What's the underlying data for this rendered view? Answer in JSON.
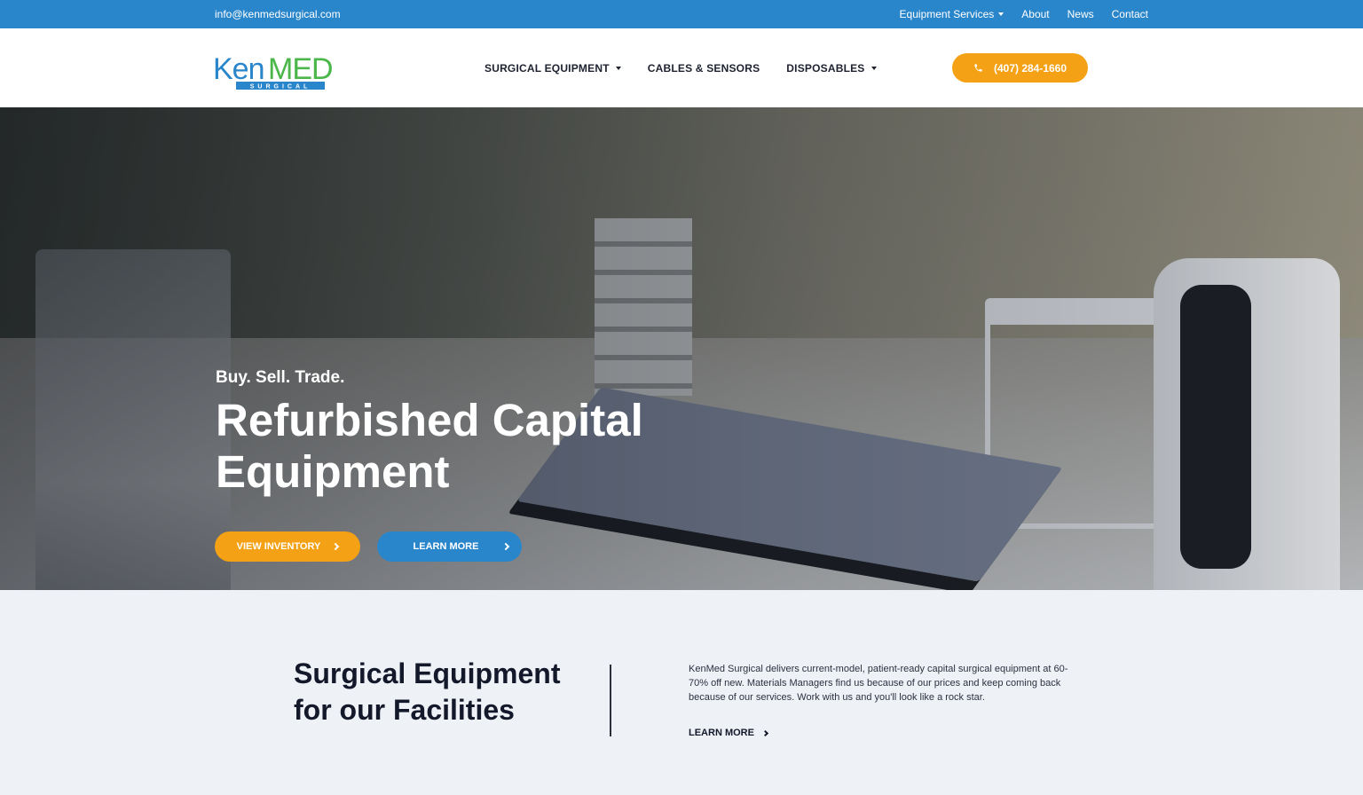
{
  "topbar": {
    "email": "info@kenmedsurgical.com",
    "links": [
      "Equipment Services",
      "About",
      "News",
      "Contact"
    ]
  },
  "header": {
    "logo_text": "KenMED",
    "logo_sub": "SURGICAL",
    "nav": [
      "SURGICAL EQUIPMENT",
      "CABLES & SENSORS",
      "DISPOSABLES"
    ],
    "phone": "(407) 284-1660"
  },
  "hero": {
    "kicker": "Buy. Sell. Trade.",
    "title": "Refurbished Capital Equipment",
    "primary_button": "VIEW INVENTORY",
    "secondary_button": "LEARN MORE"
  },
  "intro": {
    "heading": "Surgical Equipment for our Facilities",
    "body": "KenMed Surgical delivers current-model, patient-ready capital surgical equipment at 60-70% off new. Materials Managers find us because of our prices and keep coming back because of our services. Work with us and you'll look like a rock star.",
    "link": "LEARN MORE"
  },
  "colors": {
    "brand_blue": "#2a86cb",
    "brand_orange": "#f4a116",
    "logo_green": "#4bb649"
  },
  "icons": [
    "phone-icon",
    "chevron-right-icon",
    "caret-down-icon"
  ]
}
